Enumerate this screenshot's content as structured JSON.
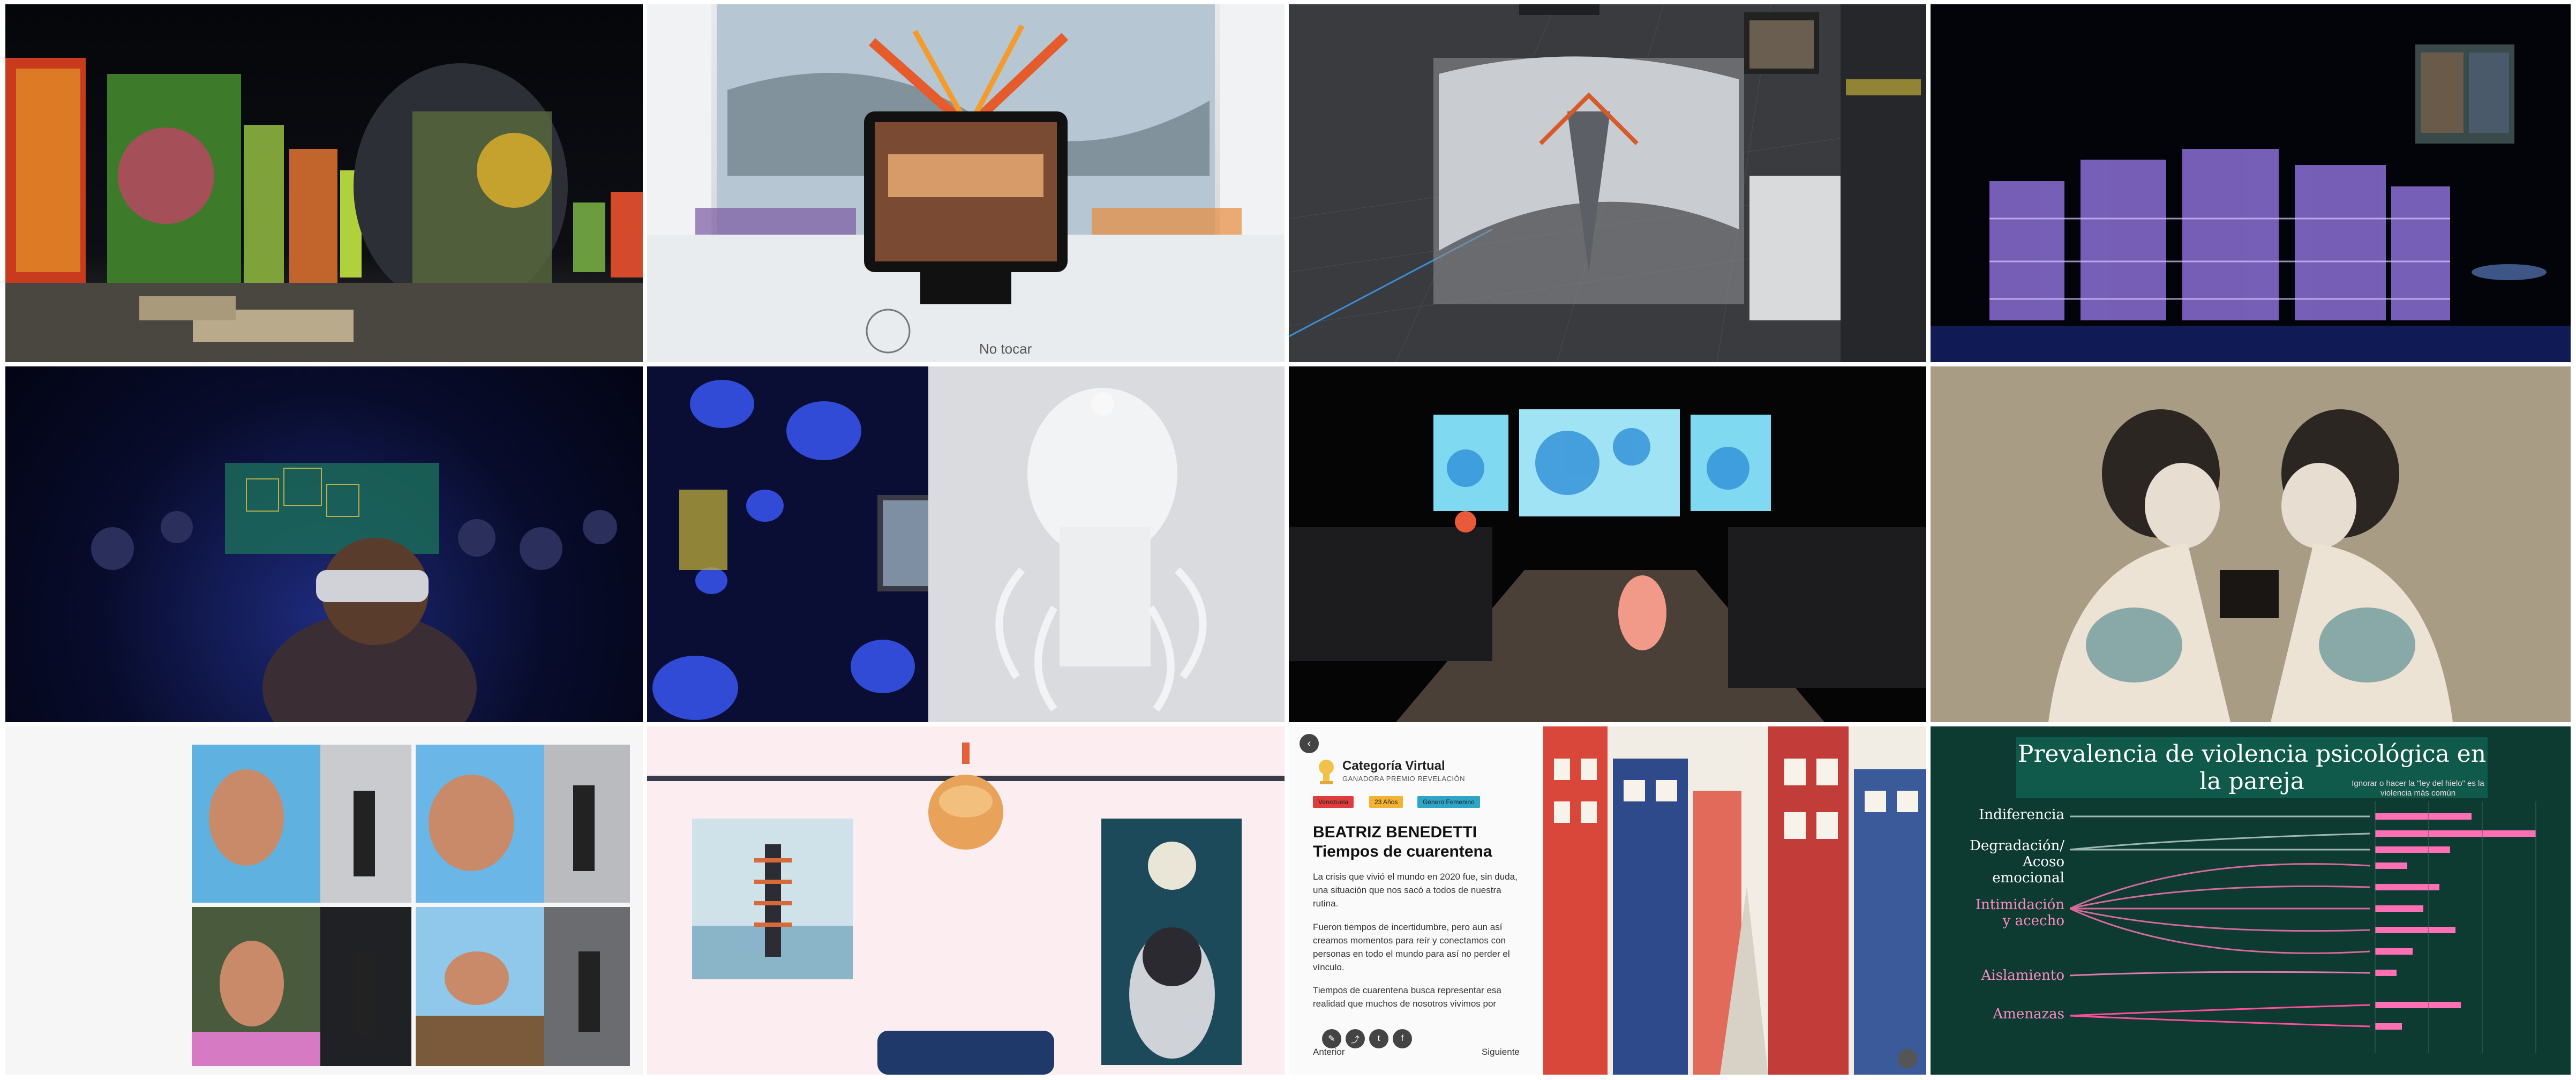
{
  "tile2": {
    "sign_text": "No tocar"
  },
  "tile11": {
    "category": "Categoría Virtual",
    "subtitle": "GANADORA PREMIO REVELACIÓN",
    "tags": [
      "Venezuela",
      "23 Años",
      "Género Femenino"
    ],
    "tag_colors": [
      "#e03c3c",
      "#f2b233",
      "#2ea4c7"
    ],
    "name_line1": "BEATRIZ BENEDETTI",
    "name_line2": "Tiempos de cuarentena",
    "paragraphs": [
      "La crisis que vivió el mundo en 2020 fue, sin duda, una situación que nos sacó a todos de nuestra rutina.",
      "Fueron tiempos de incertidumbre, pero aun así creamos momentos para reír y conectamos con personas en todo el mundo para así no perder el vínculo.",
      "Tiempos de cuarentena busca representar esa realidad que muchos de nosotros vivimos por"
    ],
    "prev_label": "Anterior",
    "next_label": "Siguiente",
    "share_icons": [
      "edit-icon",
      "share-icon",
      "twitter-icon",
      "facebook-icon"
    ]
  },
  "tile12": {
    "title": "Prevalencia de violencia psicológica en la pareja",
    "note": "Ignorar o hacer la \"ley del hielo\" es la violencia más común",
    "categories": [
      {
        "label1": "Indiferencia",
        "label2": ""
      },
      {
        "label1": "Degradación/",
        "label2": "Acoso emocional"
      },
      {
        "label1": "Intimidación",
        "label2": "y acecho"
      },
      {
        "label1": "Aislamiento",
        "label2": ""
      },
      {
        "label1": "Amenazas",
        "label2": ""
      }
    ],
    "accent": "#ff6fb3",
    "background": "#0d3b32"
  }
}
